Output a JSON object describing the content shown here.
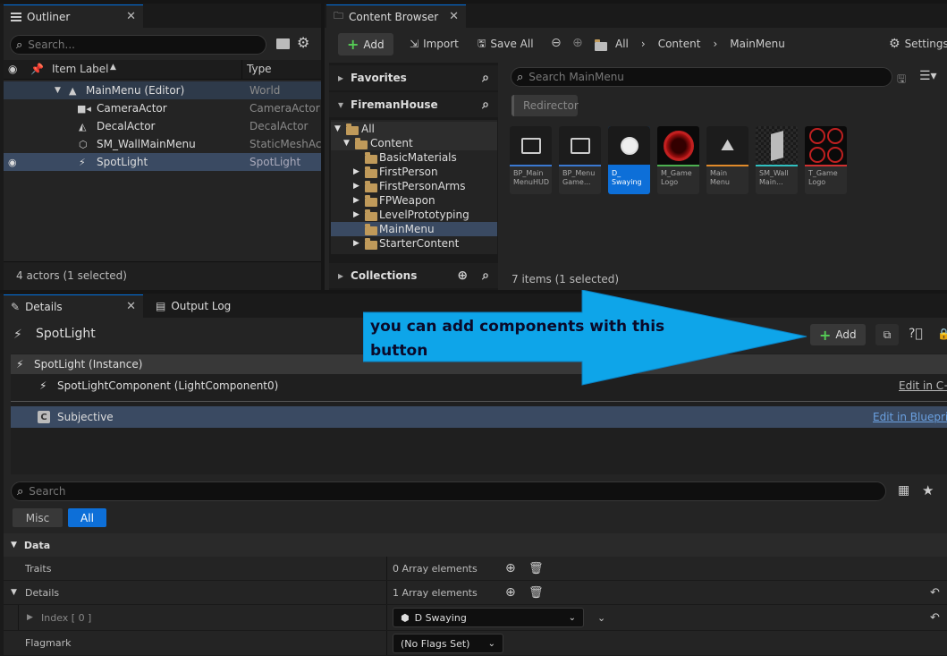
{
  "outliner": {
    "tab_label": "Outliner",
    "search_placeholder": "Search...",
    "col_label": "Item Label",
    "col_type": "Type",
    "rows": [
      {
        "label": "MainMenu (Editor)",
        "type": "World"
      },
      {
        "label": "CameraActor",
        "type": "CameraActor"
      },
      {
        "label": "DecalActor",
        "type": "DecalActor"
      },
      {
        "label": "SM_WallMainMenu",
        "type": "StaticMeshAc"
      },
      {
        "label": "SpotLight",
        "type": "SpotLight"
      }
    ],
    "status": "4 actors (1 selected)"
  },
  "content_browser": {
    "tab_label": "Content Browser",
    "add_label": "Add",
    "import_label": "Import",
    "save_all_label": "Save All",
    "breadcrumb": [
      "All",
      "Content",
      "MainMenu"
    ],
    "settings_label": "Settings",
    "favorites_label": "Favorites",
    "project_label": "FiremanHouse",
    "tree": [
      {
        "label": "All"
      },
      {
        "label": "Content"
      },
      {
        "label": "BasicMaterials"
      },
      {
        "label": "FirstPerson"
      },
      {
        "label": "FirstPersonArms"
      },
      {
        "label": "FPWeapon"
      },
      {
        "label": "LevelPrototyping"
      },
      {
        "label": "MainMenu"
      },
      {
        "label": "StarterContent"
      }
    ],
    "collections_label": "Collections",
    "search_placeholder": "Search MainMenu",
    "filter_chip": "Redirector",
    "assets": [
      {
        "label": "BP_Main MenuHUD",
        "icon": "monitor-icon",
        "color": "#3a78d0"
      },
      {
        "label": "BP_Menu Game...",
        "icon": "gamepad-icon",
        "color": "#3a78d0"
      },
      {
        "label": "D_ Swaying",
        "icon": "cube-icon",
        "color": "#0d6fd8"
      },
      {
        "label": "M_Game Logo",
        "icon": "material-icon",
        "color": "#4caf50"
      },
      {
        "label": "Main Menu",
        "icon": "level-icon",
        "color": "#e08a2a"
      },
      {
        "label": "SM_Wall Main...",
        "icon": "mesh-icon",
        "color": "#30c0c0"
      },
      {
        "label": "T_Game Logo",
        "icon": "texture-icon",
        "color": "#d03030"
      }
    ],
    "status": "7 items (1 selected)"
  },
  "details": {
    "tab_label": "Details",
    "output_tab_label": "Output Log",
    "actor_name": "SpotLight",
    "add_label": "Add",
    "annotation": "you can add components with this button",
    "components": [
      {
        "label": "SpotLight (Instance)"
      },
      {
        "label": "SpotLightComponent (LightComponent0)",
        "link": "Edit in C++"
      },
      {
        "label": "Subjective",
        "link": "Edit in Blueprint"
      }
    ],
    "search_placeholder": "Search",
    "filters": [
      "Misc",
      "All"
    ],
    "section_data": "Data",
    "props": [
      {
        "name": "Traits",
        "value": "0 Array elements"
      },
      {
        "name": "Details",
        "value": "1 Array elements"
      },
      {
        "name": "Index [ 0 ]",
        "value": "D Swaying"
      },
      {
        "name": "Flagmark",
        "value": "(No Flags Set)"
      }
    ]
  }
}
